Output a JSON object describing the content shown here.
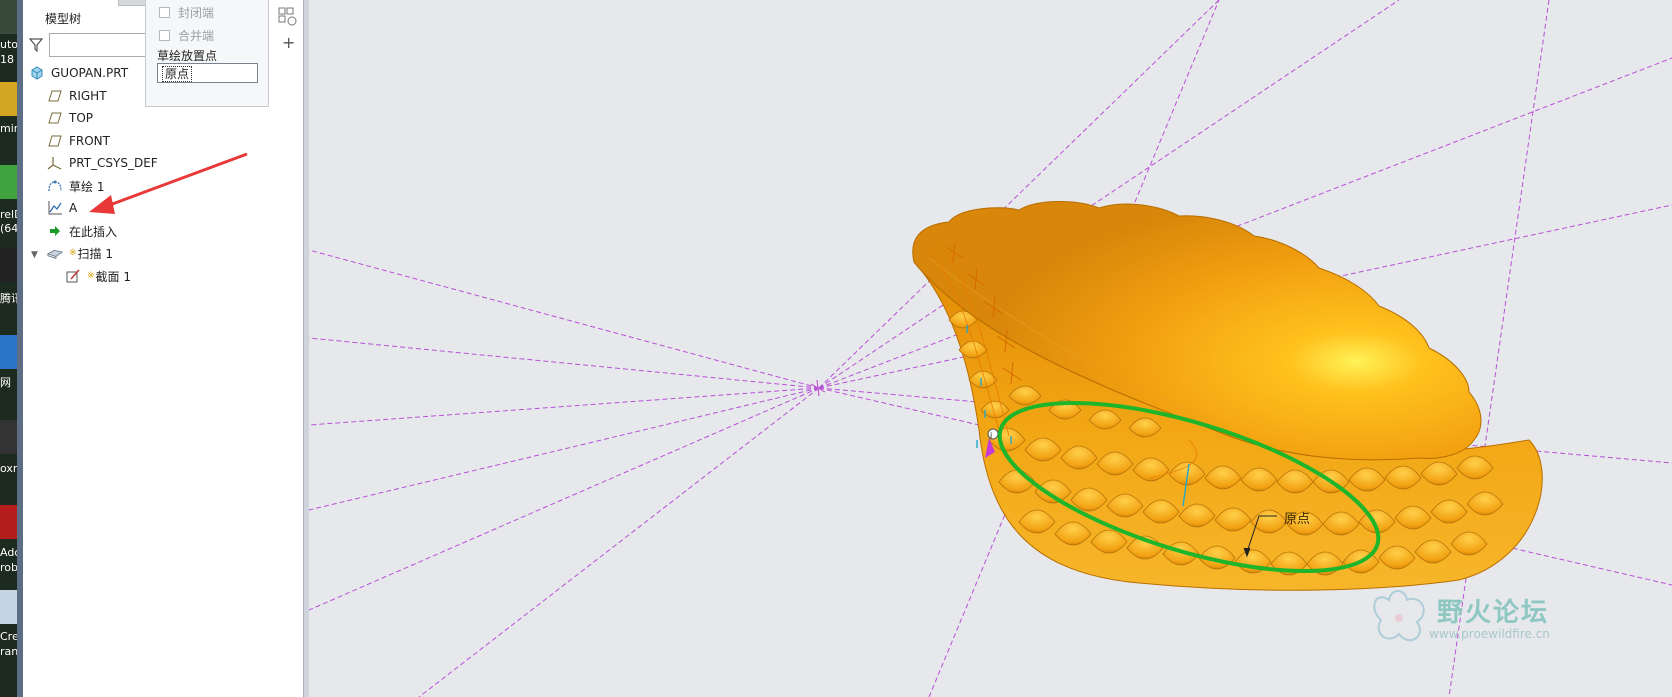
{
  "desktop": {
    "items": [
      {
        "label_top": "uto",
        "label_bottom": "18"
      },
      {
        "label_top": "min",
        "label_bottom": ""
      },
      {
        "label_top": "relD",
        "label_bottom": "(64"
      },
      {
        "label_top": "腾讯",
        "label_bottom": ""
      },
      {
        "label_top": "网",
        "label_bottom": ""
      },
      {
        "label_top": "oxn",
        "label_bottom": ""
      },
      {
        "label_top": "Ado",
        "label_bottom": "rob"
      },
      {
        "label_top": "Cre",
        "label_bottom": "ran"
      }
    ]
  },
  "model_tree": {
    "title": "模型树",
    "search_value": "",
    "items": [
      {
        "label": "GUOPAN.PRT",
        "icon": "part-icon"
      },
      {
        "label": "RIGHT",
        "icon": "datum-plane-icon"
      },
      {
        "label": "TOP",
        "icon": "datum-plane-icon"
      },
      {
        "label": "FRONT",
        "icon": "datum-plane-icon"
      },
      {
        "label": "PRT_CSYS_DEF",
        "icon": "coordinate-system-icon"
      },
      {
        "label": "草绘 1",
        "icon": "sketch-icon"
      },
      {
        "label": "A",
        "icon": "graph-icon"
      },
      {
        "label": "在此插入",
        "icon": "insert-here-arrow-icon"
      },
      {
        "label": "扫描 1",
        "icon": "sweep-feature-icon"
      },
      {
        "label": "截面 1",
        "icon": "section-icon"
      }
    ]
  },
  "popup": {
    "checkbox_closed": "封闭端",
    "checkbox_merge": "合并端",
    "placement_label": "草绘放置点",
    "placement_value": "原点"
  },
  "viewport": {
    "origin_label": "原点",
    "watermark_name": "野火论坛",
    "watermark_url": "www.proewildfire.cn"
  },
  "colors": {
    "part": "#f29f12",
    "part_highlight": "#fff04a",
    "trajectory": "#1fb52a",
    "datum_lines": "#b43fd6",
    "annotation_arrow": "#e83838"
  }
}
